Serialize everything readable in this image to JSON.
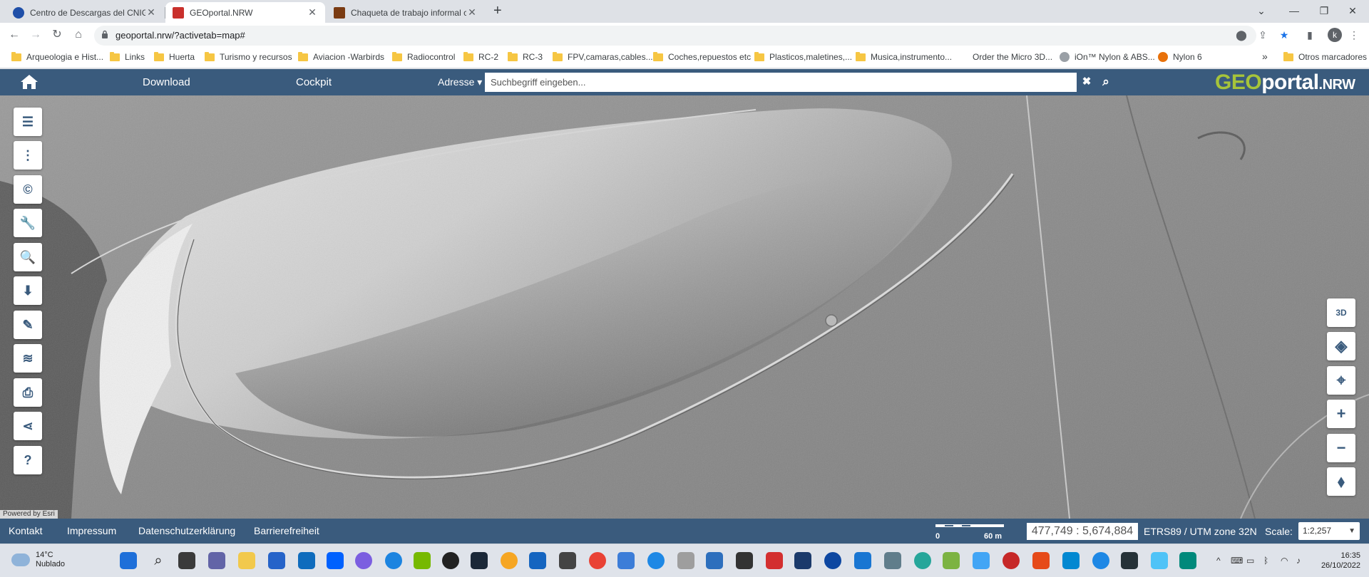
{
  "browser": {
    "tabs": [
      {
        "title": "Centro de Descargas del CNIG (IGN)",
        "active": false,
        "favicon_color": "#1f4fa8"
      },
      {
        "title": "GEOportal.NRW",
        "active": true,
        "favicon_color": "#c9302c"
      },
      {
        "title": "Chaqueta de trabajo informal cálida",
        "active": false,
        "favicon_color": "#7a3b12"
      }
    ],
    "close_glyph": "✕",
    "new_tab_glyph": "+",
    "url": "geoportal.nrw/?activetab=map#",
    "profile_initial": "k",
    "bookmarks": [
      {
        "label": "Arqueologia e Hist...",
        "type": "folder"
      },
      {
        "label": "Links",
        "type": "folder"
      },
      {
        "label": "Huerta",
        "type": "folder"
      },
      {
        "label": "Turismo y recursos",
        "type": "folder"
      },
      {
        "label": "Aviacion -Warbirds",
        "type": "folder"
      },
      {
        "label": "Radiocontrol",
        "type": "folder"
      },
      {
        "label": "RC-2",
        "type": "folder"
      },
      {
        "label": "RC-3",
        "type": "folder"
      },
      {
        "label": "FPV,camaras,cables...",
        "type": "folder"
      },
      {
        "label": "Coches,repuestos etc",
        "type": "folder"
      },
      {
        "label": "Plasticos,maletines,...",
        "type": "folder"
      },
      {
        "label": "Musica,instrumento...",
        "type": "folder"
      },
      {
        "label": "Order the Micro 3D...",
        "type": "site"
      },
      {
        "label": "iOn™ Nylon & ABS...",
        "type": "site"
      },
      {
        "label": "Nylon 6",
        "type": "site"
      }
    ],
    "bookmarks_overflow": "»",
    "other_bookmarks": "Otros marcadores"
  },
  "app": {
    "nav": {
      "download": "Download",
      "cockpit": "Cockpit"
    },
    "search": {
      "mode_label": "Adresse ▾",
      "placeholder": "Suchbegriff eingeben...",
      "clear_glyph": "✖",
      "search_glyph": "⌕"
    },
    "brand": {
      "geo": "GEO",
      "portal": "portal",
      "nrw": ".NRW"
    },
    "left_tools": [
      {
        "name": "layer-list-button",
        "glyph": "☰"
      },
      {
        "name": "more-menu-button",
        "glyph": "⋮"
      },
      {
        "name": "copyright-button",
        "glyph": "©"
      },
      {
        "name": "tools-button",
        "glyph": "🔧"
      },
      {
        "name": "search-data-button",
        "glyph": "🔍"
      },
      {
        "name": "download-button",
        "glyph": "⬇"
      },
      {
        "name": "draw-button",
        "glyph": "✎"
      },
      {
        "name": "add-layer-button",
        "glyph": "≋"
      },
      {
        "name": "print-button",
        "glyph": "⎙"
      },
      {
        "name": "share-button",
        "glyph": "⋖"
      },
      {
        "name": "help-button",
        "glyph": "?"
      }
    ],
    "right_tools": [
      {
        "name": "3d-view-button",
        "glyph": "3D"
      },
      {
        "name": "layers-button",
        "glyph": "◈"
      },
      {
        "name": "locate-button",
        "glyph": "⌖"
      },
      {
        "name": "zoom-in-button",
        "glyph": "+"
      },
      {
        "name": "zoom-out-button",
        "glyph": "−"
      },
      {
        "name": "north-arrow-button",
        "glyph": "⬧"
      }
    ],
    "attribution": "Powered by Esri",
    "footer": {
      "links": [
        "Kontakt",
        "Impressum",
        "Datenschutzerklärung",
        "Barrierefreiheit"
      ],
      "scalebar": {
        "start": "0",
        "end": "60 m"
      },
      "coordinates": "477,749 : 5,674,884",
      "crs": "ETRS89 / UTM zone 32N",
      "scale_label": "Scale:",
      "scale_value": "1:2,257"
    }
  },
  "taskbar": {
    "weather": {
      "temp": "14°C",
      "condition": "Nublado"
    },
    "time": "16:35",
    "date": "26/10/2022"
  },
  "colors": {
    "app_blue": "#3a5b7d",
    "brand_green": "#a6c43a",
    "tab_bg": "#dee1e6"
  }
}
